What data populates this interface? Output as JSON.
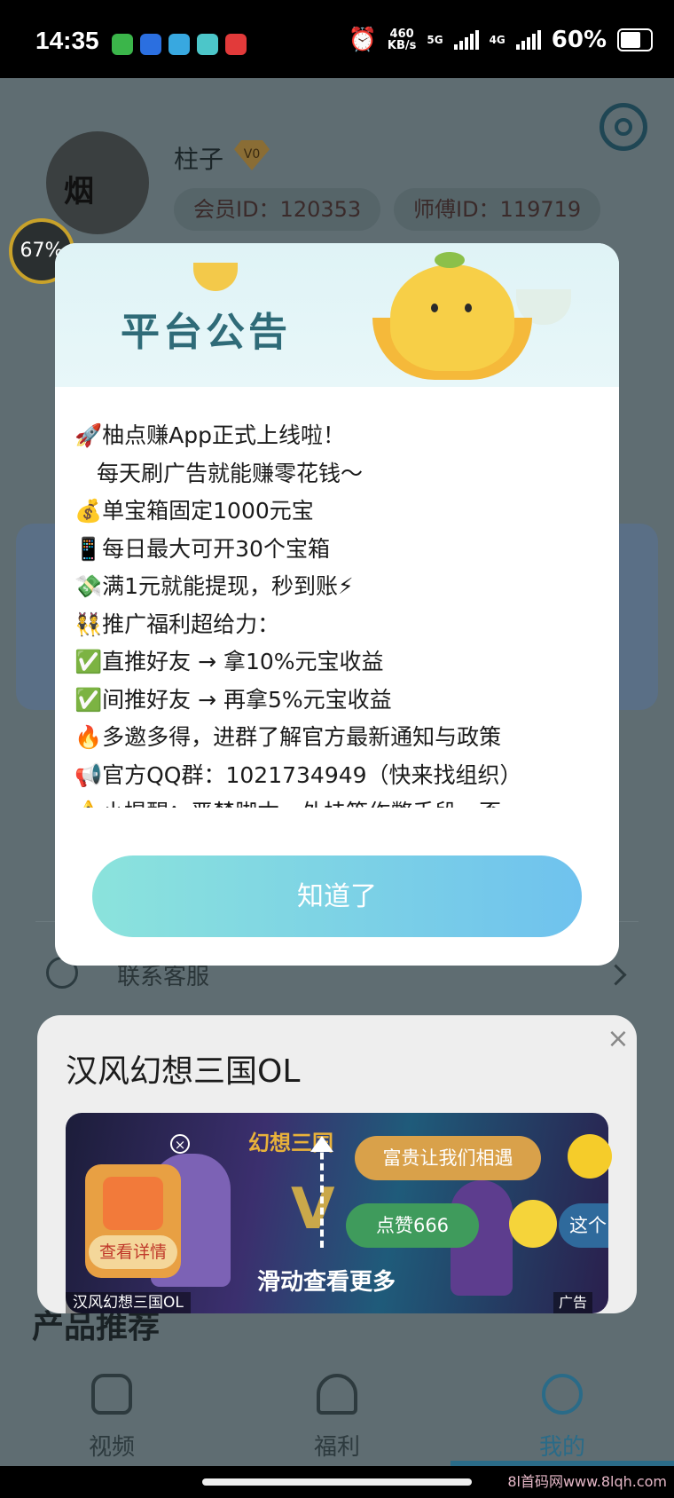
{
  "status_bar": {
    "time": "14:35",
    "net_speed": "460",
    "net_unit": "KB/s",
    "sim1": "5G",
    "sim2": "4G",
    "battery": "60%",
    "icons": [
      "alarm-icon",
      "signal-5g-icon",
      "signal-4g-icon",
      "battery-icon"
    ]
  },
  "profile": {
    "username": "柱子",
    "vip_level": "V0",
    "member_id": "会员ID：120353",
    "master_id": "师傅ID：119719",
    "avatar_text": "烟"
  },
  "floating_progress": "67%",
  "notice": {
    "title": "平台公告",
    "lines": [
      "🚀柚点赚App正式上线啦！",
      "　每天刷广告就能赚零花钱～",
      "💰单宝箱固定1000元宝",
      "📱每日最大可开30个宝箱",
      "💸满1元就能提现，秒到账⚡",
      "👯推广福利超给力：",
      "✅直推好友 → 拿10%元宝收益",
      "✅间推好友 → 再拿5%元宝收益",
      "🔥多邀多得，进群了解官方最新通知与政策",
      "📢官方QQ群：1021734949（快来找组织）",
      "⚠️小提醒：严禁脚本、外挂等作弊手段，否"
    ],
    "confirm_button": "知道了"
  },
  "menu": {
    "customer_service": "联系客服"
  },
  "ad": {
    "title": "汉风幻想三国OL",
    "gift_label": "查看详情",
    "chip_1": "富贵让我们相遇",
    "chip_2": "点赞666",
    "chip_3": "这个",
    "swipe_hint": "滑动查看更多",
    "source": "汉风幻想三国OL",
    "tag": "广告",
    "logo_text": "幻想三国"
  },
  "section_title": "产品推荐",
  "tabs": [
    {
      "label": "视频",
      "active": false
    },
    {
      "label": "福利",
      "active": false
    },
    {
      "label": "我的",
      "active": true
    }
  ],
  "watermark": "8l首码网www.8lqh.com",
  "colors": {
    "accent": "#2a6b88",
    "button_gradient_start": "#8be3dc",
    "button_gradient_end": "#6fc2ee",
    "notice_title": "#2f6b78"
  }
}
